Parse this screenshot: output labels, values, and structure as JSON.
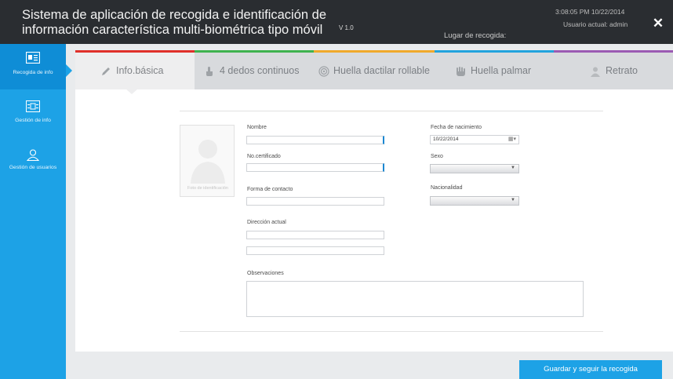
{
  "header": {
    "title_line1": "Sistema de aplicación de recogida e identificación de",
    "title_line2": "información característica multi-biométrica tipo móvil",
    "version": "V 1.0",
    "location_label": "Lugar de recogida:",
    "timestamp": "3:08:05 PM 10/22/2014",
    "user": "Usuario actual: admin",
    "close_glyph": "✕"
  },
  "sidebar": {
    "items": [
      {
        "label": "Recogida de info",
        "icon": "id-card-icon"
      },
      {
        "label": "Gestión de info",
        "icon": "info-card-icon"
      },
      {
        "label": "Gestión de usuarios",
        "icon": "user-icon"
      }
    ]
  },
  "tabs": [
    {
      "label": "Info.básica",
      "color": "#e0302a",
      "icon": "pencil-icon"
    },
    {
      "label": "4 dedos continuos",
      "color": "#3fb34f",
      "icon": "finger-icon"
    },
    {
      "label": "Huella dactilar rollable",
      "color": "#f0a92c",
      "icon": "fingerprint-icon"
    },
    {
      "label": "Huella palmar",
      "color": "#22a3dd",
      "icon": "palm-icon"
    },
    {
      "label": "Retrato",
      "color": "#9b5bb3",
      "icon": "portrait-icon"
    }
  ],
  "form": {
    "photo_caption": "Foto de identificación",
    "nombre_label": "Nombre",
    "certificado_label": "No.certificado",
    "contacto_label": "Forma de contacto",
    "direccion_label": "Dirección actual",
    "observaciones_label": "Observaciones",
    "fecha_label": "Fecha de nacimiento",
    "fecha_value": "10/22/2014",
    "sexo_label": "Sexo",
    "nacionalidad_label": "Nacionalidad"
  },
  "actions": {
    "save_label": "Guardar y seguir la recogida"
  }
}
